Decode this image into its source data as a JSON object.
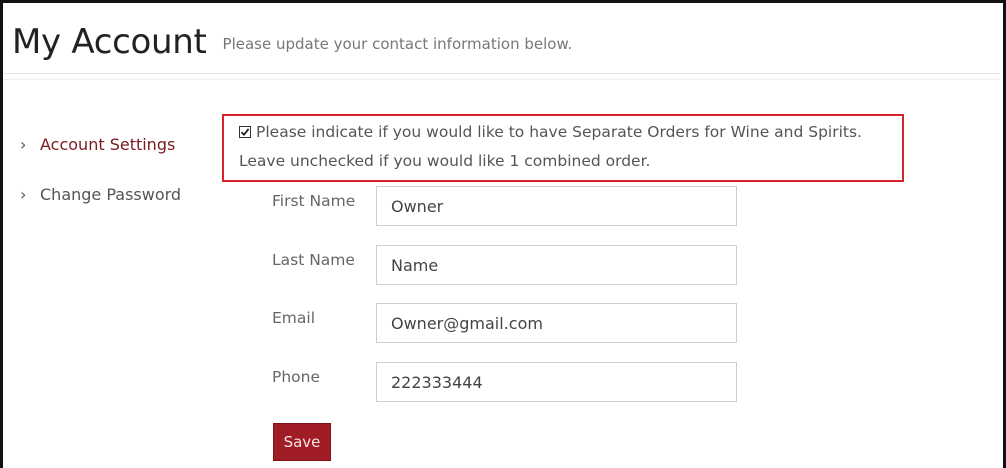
{
  "header": {
    "title": "My Account",
    "subtitle": "Please update your contact information below."
  },
  "sidebar": {
    "items": [
      {
        "label": "Account Settings",
        "active": true,
        "icon": "chevron-right-icon"
      },
      {
        "label": "Change Password",
        "active": false,
        "icon": "chevron-right-icon"
      }
    ]
  },
  "notice": {
    "checked": true,
    "line1": "Please indicate if you would like to have Separate Orders for Wine and Spirits.",
    "line2": "Leave unchecked if you would like 1 combined order."
  },
  "form": {
    "first_name": {
      "label": "First Name",
      "value": "Owner"
    },
    "last_name": {
      "label": "Last Name",
      "value": "Name"
    },
    "email": {
      "label": "Email",
      "value": "Owner@gmail.com"
    },
    "phone": {
      "label": "Phone",
      "value": "222333444"
    },
    "save_label": "Save"
  },
  "colors": {
    "accent": "#a11d26",
    "highlight_border": "#d9232b",
    "active_link": "#7a1a1f"
  }
}
